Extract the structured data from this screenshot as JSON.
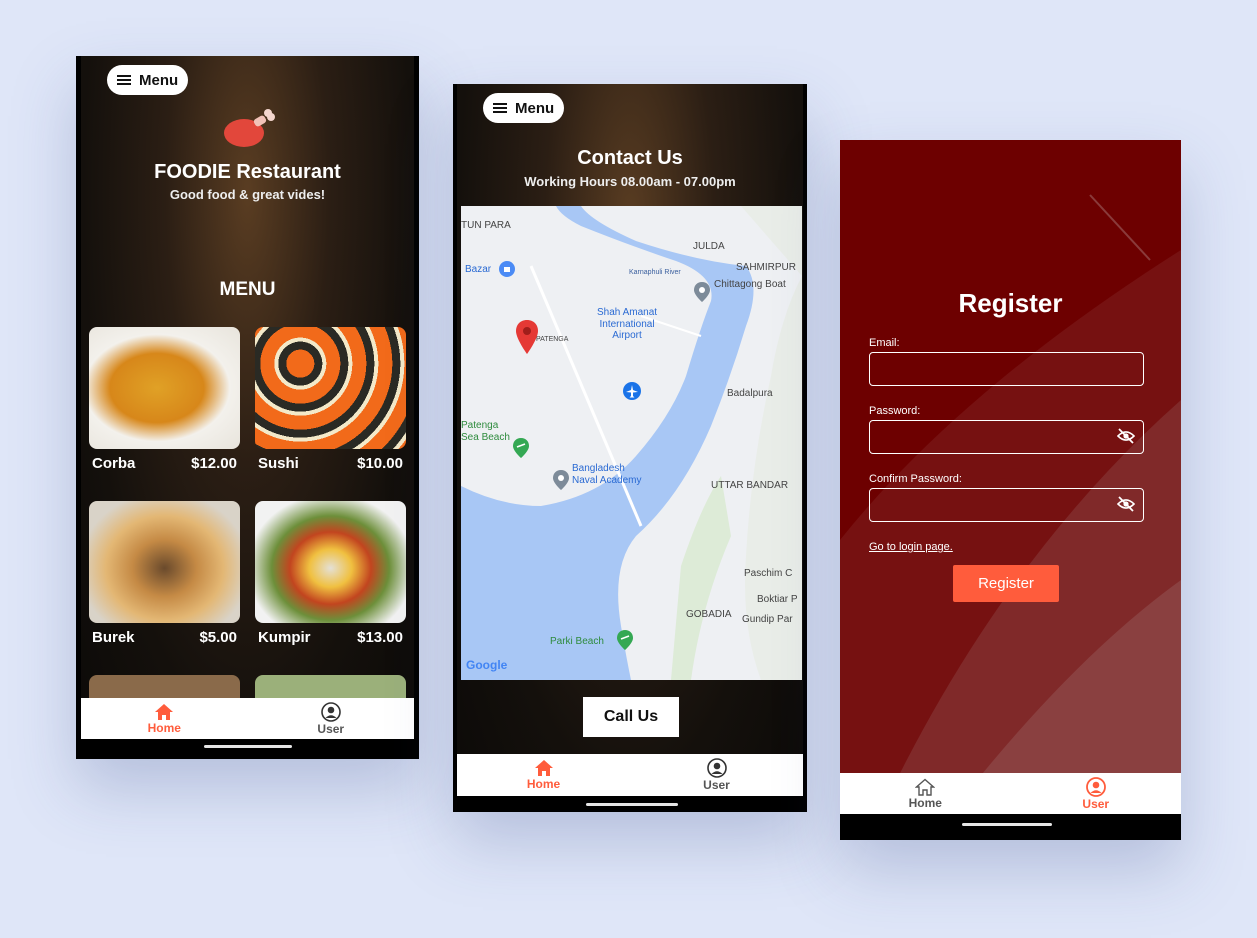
{
  "screens": {
    "menu": {
      "menu_label": "Menu",
      "restaurant_name": "FOODIE Restaurant",
      "tagline": "Good food & great vides!",
      "section_title": "MENU",
      "items": [
        {
          "name": "Corba",
          "price": "$12.00"
        },
        {
          "name": "Sushi",
          "price": "$10.00"
        },
        {
          "name": "Burek",
          "price": "$5.00"
        },
        {
          "name": "Kumpir",
          "price": "$13.00"
        }
      ],
      "nav": {
        "home": "Home",
        "user": "User"
      }
    },
    "contact": {
      "menu_label": "Menu",
      "title": "Contact Us",
      "hours": "Working Hours 08.00am - 07.00pm",
      "map_labels": {
        "tun_para": "TUN\nPARA",
        "bazar": "Bazar",
        "julda": "JULDA",
        "sahmirpur": "SAHMIRPUR",
        "karnaphuli": "Karnaphuli River",
        "chittagong_boat": "Chittagong Boat",
        "airport": "Shah Amanat\nInternational\nAirport",
        "patenga": "PATENGA",
        "badalpura": "Badalpura",
        "patenga_beach": "Patenga\nSea Beach",
        "naval_academy": "Bangladesh\nNaval Academy",
        "uttar_bandar": "UTTAR BANDAR",
        "paschim": "Paschim C",
        "boktiar": "Boktiar P",
        "gobadia": "GOBADIA",
        "gundip": "Gundip Par",
        "parki_beach": "Parki Beach",
        "google": "Google"
      },
      "call_button": "Call Us",
      "nav": {
        "home": "Home",
        "user": "User"
      }
    },
    "register": {
      "title": "Register",
      "email_label": "Email:",
      "password_label": "Password:",
      "confirm_label": "Confirm Password:",
      "login_link": "Go to login page.",
      "register_button": "Register",
      "nav": {
        "home": "Home",
        "user": "User"
      }
    }
  },
  "colors": {
    "accent": "#ff5c3c",
    "background": "#dfe6f8",
    "register_bg": "#6d0000",
    "water": "#a8c7f5"
  }
}
